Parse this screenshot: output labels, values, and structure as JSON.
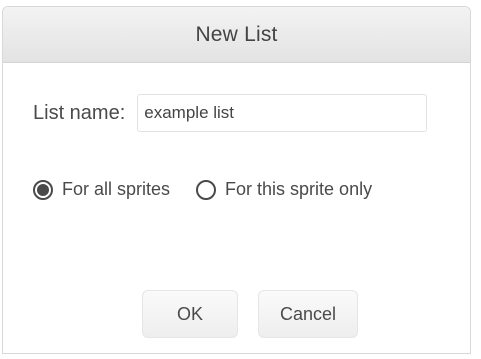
{
  "dialog": {
    "title": "New List"
  },
  "list_name": {
    "label": "List name:",
    "value": "example list"
  },
  "scope": {
    "options": [
      {
        "label": "For all sprites",
        "selected": true
      },
      {
        "label": "For this sprite only",
        "selected": false
      }
    ]
  },
  "buttons": {
    "ok_label": "OK",
    "cancel_label": "Cancel"
  },
  "colors": {
    "text": "#4a4a4a",
    "titlebar_top": "#f3f3f3",
    "titlebar_bottom": "#e3e3e3",
    "border": "#d8d8d8"
  }
}
